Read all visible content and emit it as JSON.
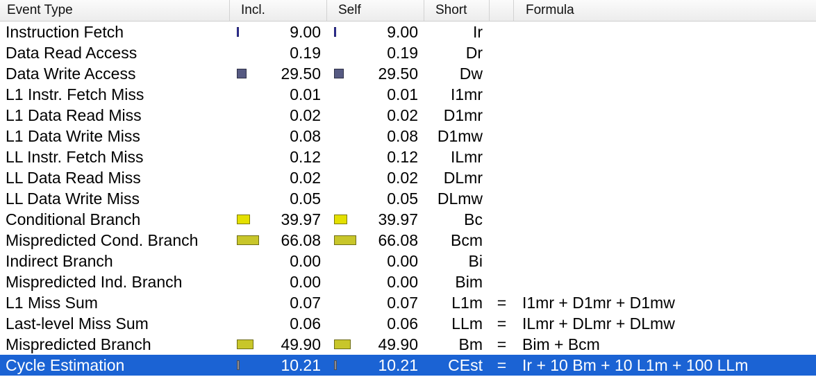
{
  "header": {
    "event_type": "Event Type",
    "incl": "Incl.",
    "self": "Self",
    "short": "Short",
    "formula": "Formula"
  },
  "colors": {
    "selection": "#1b63d4",
    "bar_memory": "#565a82",
    "bar_branch": "#e4e000",
    "bar_branch_dark": "#c8c62a",
    "bar_cycle": "#8a8c96"
  },
  "rows": [
    {
      "name": "Instruction Fetch",
      "incl": "9.00",
      "self": "9.00",
      "short": "Ir",
      "eq": "",
      "formula": "",
      "bar_fraction": 0.1,
      "bar_color": "#3a3ab8"
    },
    {
      "name": "Data Read Access",
      "incl": "0.19",
      "self": "0.19",
      "short": "Dr",
      "eq": "",
      "formula": "",
      "bar_fraction": 0,
      "bar_color": "#565a82"
    },
    {
      "name": "Data Write Access",
      "incl": "29.50",
      "self": "29.50",
      "short": "Dw",
      "eq": "",
      "formula": "",
      "bar_fraction": 0.4,
      "bar_color": "#565a82"
    },
    {
      "name": "L1 Instr. Fetch Miss",
      "incl": "0.01",
      "self": "0.01",
      "short": "I1mr",
      "eq": "",
      "formula": "",
      "bar_fraction": 0,
      "bar_color": "#565a82"
    },
    {
      "name": "L1 Data Read Miss",
      "incl": "0.02",
      "self": "0.02",
      "short": "D1mr",
      "eq": "",
      "formula": "",
      "bar_fraction": 0,
      "bar_color": "#565a82"
    },
    {
      "name": "L1 Data Write Miss",
      "incl": "0.08",
      "self": "0.08",
      "short": "D1mw",
      "eq": "",
      "formula": "",
      "bar_fraction": 0,
      "bar_color": "#565a82"
    },
    {
      "name": "LL Instr. Fetch Miss",
      "incl": "0.12",
      "self": "0.12",
      "short": "ILmr",
      "eq": "",
      "formula": "",
      "bar_fraction": 0,
      "bar_color": "#565a82"
    },
    {
      "name": "LL Data Read Miss",
      "incl": "0.02",
      "self": "0.02",
      "short": "DLmr",
      "eq": "",
      "formula": "",
      "bar_fraction": 0,
      "bar_color": "#565a82"
    },
    {
      "name": "LL Data Write Miss",
      "incl": "0.05",
      "self": "0.05",
      "short": "DLmw",
      "eq": "",
      "formula": "",
      "bar_fraction": 0,
      "bar_color": "#565a82"
    },
    {
      "name": "Conditional Branch",
      "incl": "39.97",
      "self": "39.97",
      "short": "Bc",
      "eq": "",
      "formula": "",
      "bar_fraction": 0.55,
      "bar_color": "#e4e000"
    },
    {
      "name": "Mispredicted Cond. Branch",
      "incl": "66.08",
      "self": "66.08",
      "short": "Bcm",
      "eq": "",
      "formula": "",
      "bar_fraction": 0.95,
      "bar_color": "#c8c62a"
    },
    {
      "name": "Indirect Branch",
      "incl": "0.00",
      "self": "0.00",
      "short": "Bi",
      "eq": "",
      "formula": "",
      "bar_fraction": 0,
      "bar_color": "#e4e000"
    },
    {
      "name": "Mispredicted Ind. Branch",
      "incl": "0.00",
      "self": "0.00",
      "short": "Bim",
      "eq": "",
      "formula": "",
      "bar_fraction": 0,
      "bar_color": "#e4e000"
    },
    {
      "name": "L1 Miss Sum",
      "incl": "0.07",
      "self": "0.07",
      "short": "L1m",
      "eq": "=",
      "formula": "I1mr + D1mr + D1mw",
      "bar_fraction": 0,
      "bar_color": "#565a82"
    },
    {
      "name": "Last-level Miss Sum",
      "incl": "0.06",
      "self": "0.06",
      "short": "LLm",
      "eq": "=",
      "formula": "ILmr + DLmr + DLmw",
      "bar_fraction": 0,
      "bar_color": "#565a82"
    },
    {
      "name": "Mispredicted Branch",
      "incl": "49.90",
      "self": "49.90",
      "short": "Bm",
      "eq": "=",
      "formula": "Bim + Bcm",
      "bar_fraction": 0.72,
      "bar_color": "#c8c62a"
    },
    {
      "name": "Cycle Estimation",
      "incl": "10.21",
      "self": "10.21",
      "short": "CEst",
      "eq": "=",
      "formula": "Ir + 10 Bm + 10 L1m + 100 LLm",
      "bar_fraction": 0.12,
      "bar_color": "#8a8c96",
      "selected": true
    }
  ]
}
